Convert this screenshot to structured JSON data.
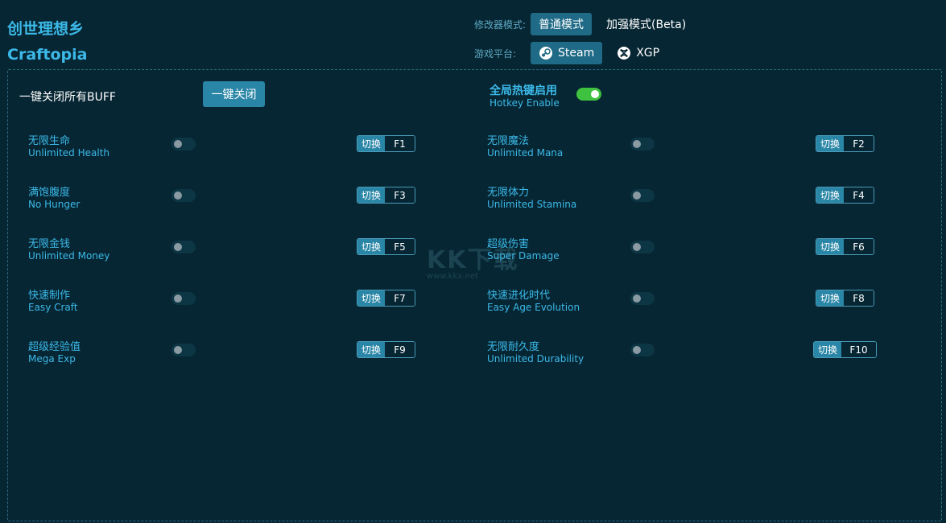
{
  "app": {
    "title_cn": "创世理想乡",
    "title_en": "Craftopia"
  },
  "mode": {
    "label": "修改器模式:",
    "options": [
      "普通模式",
      "加强模式(Beta)"
    ],
    "selected": "普通模式"
  },
  "platform": {
    "label": "游戏平台:",
    "options": [
      "Steam",
      "XGP"
    ],
    "selected": "Steam"
  },
  "close_all": {
    "label": "一键关闭所有BUFF",
    "button": "一键关闭"
  },
  "hotkey": {
    "label_cn": "全局热键启用",
    "label_en": "Hotkey Enable",
    "enabled": true
  },
  "switch_label": "切换",
  "cheats": [
    {
      "cn": "无限生命",
      "en": "Unlimited Health",
      "key": "F1",
      "enabled": false
    },
    {
      "cn": "无限魔法",
      "en": "Unlimited Mana",
      "key": "F2",
      "enabled": false
    },
    {
      "cn": "满饱腹度",
      "en": "No Hunger",
      "key": "F3",
      "enabled": false
    },
    {
      "cn": "无限体力",
      "en": "Unlimited Stamina",
      "key": "F4",
      "enabled": false
    },
    {
      "cn": "无限金钱",
      "en": "Unlimited Money",
      "key": "F5",
      "enabled": false
    },
    {
      "cn": "超级伤害",
      "en": "Super Damage",
      "key": "F6",
      "enabled": false
    },
    {
      "cn": "快速制作",
      "en": "Easy Craft",
      "key": "F7",
      "enabled": false
    },
    {
      "cn": "快速进化时代",
      "en": "Easy Age Evolution",
      "key": "F8",
      "enabled": false
    },
    {
      "cn": "超级经验值",
      "en": "Mega Exp",
      "key": "F9",
      "enabled": false
    },
    {
      "cn": "无限耐久度",
      "en": "Unlimited Durability",
      "key": "F10",
      "enabled": false
    }
  ],
  "watermark": {
    "logo": "KK下载",
    "url": "www.kkx.net"
  },
  "colors": {
    "background": "#062633",
    "accent": "#3cb9e8",
    "button": "#2a86a6",
    "toggle_on": "#3fc23f"
  }
}
